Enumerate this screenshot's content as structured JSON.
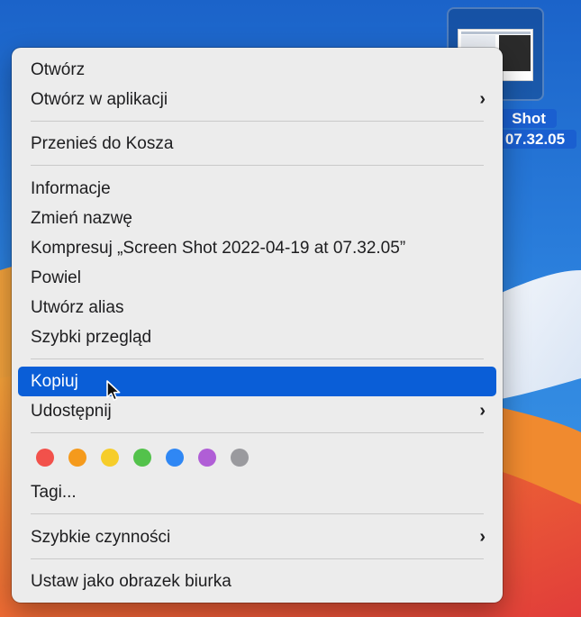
{
  "desktop": {
    "file_label_line1": "Shot",
    "file_label_line2": "07.32.05"
  },
  "menu": {
    "open": "Otwórz",
    "open_with": "Otwórz w aplikacji",
    "move_to_trash": "Przenieś do Kosza",
    "get_info": "Informacje",
    "rename": "Zmień nazwę",
    "compress": "Kompresuj „Screen Shot 2022-04-19 at 07.32.05”",
    "duplicate": "Powiel",
    "make_alias": "Utwórz alias",
    "quick_look": "Szybki przegląd",
    "copy": "Kopiuj",
    "share": "Udostępnij",
    "tags": "Tagi...",
    "quick_actions": "Szybkie czynności",
    "set_desktop_picture": "Ustaw jako obrazek biurka",
    "submenu_chevron": "›"
  },
  "tag_colors": {
    "red": "#f2514b",
    "orange": "#f59a1c",
    "yellow": "#f6cd2a",
    "green": "#53c24b",
    "blue": "#2f87f4",
    "purple": "#b05ed6",
    "gray": "#9a9a9e"
  },
  "colors": {
    "menu_background": "#ececec",
    "highlight": "#0a5ed7"
  }
}
